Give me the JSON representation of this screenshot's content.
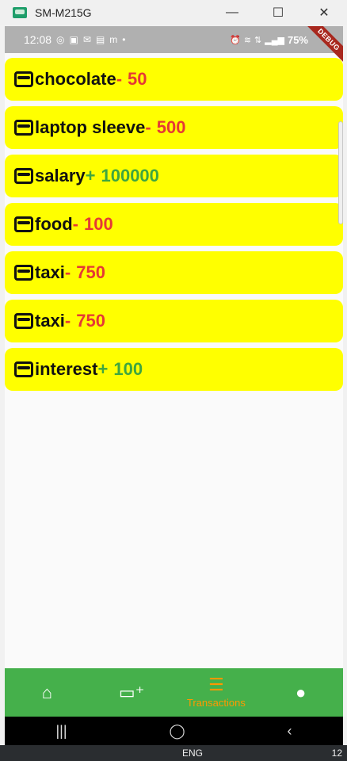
{
  "window": {
    "title": "SM-M215G",
    "minimize_icon": "minimize-icon",
    "maximize_icon": "maximize-icon",
    "close_icon": "close-icon"
  },
  "statusbar": {
    "time": "12:08",
    "icons": [
      "whatsapp-icon",
      "linkedin-icon",
      "mail-icon",
      "gallery-icon",
      "m-icon",
      "dot-icon"
    ],
    "right_icons": [
      "alarm-icon",
      "volte-icon",
      "lte-icon",
      "signal-icon"
    ],
    "battery": "75%",
    "debug_banner": "DEBUG"
  },
  "transactions": [
    {
      "label": "chocolate",
      "sign": "-",
      "amount": "50",
      "type": "expense"
    },
    {
      "label": "laptop sleeve",
      "sign": "-",
      "amount": "500",
      "type": "expense"
    },
    {
      "label": "salary",
      "sign": "+",
      "amount": "100000",
      "type": "income"
    },
    {
      "label": "food",
      "sign": "-",
      "amount": "100",
      "type": "expense"
    },
    {
      "label": "taxi",
      "sign": "-",
      "amount": "750",
      "type": "expense"
    },
    {
      "label": "taxi",
      "sign": "-",
      "amount": "750",
      "type": "expense"
    },
    {
      "label": "interest",
      "sign": "+",
      "amount": "100",
      "type": "income"
    }
  ],
  "bottom_nav": {
    "items": [
      {
        "icon": "home-icon",
        "label": ""
      },
      {
        "icon": "add-card-icon",
        "label": ""
      },
      {
        "icon": "list-icon",
        "label": "Transactions"
      },
      {
        "icon": "person-icon",
        "label": ""
      }
    ],
    "active_index": 2
  },
  "system_nav": {
    "recent": "|||",
    "home": "◯",
    "back": "‹"
  },
  "taskbar": {
    "lang": "ENG",
    "time": "12"
  },
  "colors": {
    "item_bg": "#ffff00",
    "expense": "#e53935",
    "income": "#3fa63f",
    "nav_bg": "#45b04b",
    "nav_active": "#ff9800"
  }
}
